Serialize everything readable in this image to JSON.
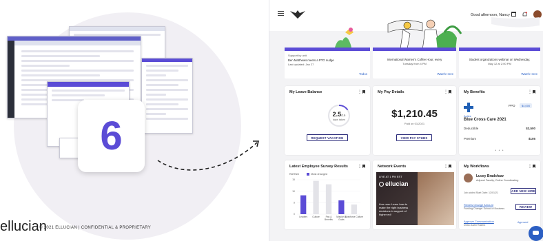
{
  "left": {
    "step_number": "6",
    "brand": "ellucian",
    "copyright": "© 2021 ELLUCIAN | CONFIDENTIAL & PROPRIETARY"
  },
  "header": {
    "greeting": "Good afternoon, Nancy"
  },
  "promos": [
    {
      "title": "Support by unit",
      "line1": "Ben Matthews meets a PTO nudge",
      "line2": "Last updated: Jan 27",
      "link": "Todos"
    },
    {
      "title": "International Women's Coffee Hour, every",
      "line1": "Tuesday from 4 PM",
      "line2": "",
      "link": "Watch Here"
    },
    {
      "title": "Student organizations webinar on Wednesday,",
      "line1": "May 12 at 2:00 PM",
      "line2": "",
      "link": "Watch Here"
    }
  ],
  "cards": {
    "leave": {
      "title": "My Leave Balance",
      "value": "2.5",
      "total": "/16",
      "unit": "days taken",
      "button": "REQUEST VACATION",
      "fraction_used": 0.156
    },
    "pay": {
      "title": "My Pay Details",
      "amount": "$1,210.45",
      "date": "Paid on 01/2021",
      "button": "VIEW PAY STUBS"
    },
    "benefits": {
      "title": "My Benefits",
      "plan_type": "PPO",
      "badge": "$4,000",
      "status": "Active",
      "plan_name": "Blue Cross Care 2021",
      "rows": [
        {
          "label": "Deductible",
          "value": "$3,500"
        },
        {
          "label": "Premium",
          "value": "$105"
        }
      ]
    },
    "survey": {
      "title": "Latest Employee Survey Results",
      "legend_left": "RATING",
      "legend_right": "Most changed",
      "chart_data": {
        "type": "bar",
        "categories": [
          "Leaders",
          "Culture",
          "Pay & Benefits",
          "Mission & Goals",
          "Workforce Culture"
        ],
        "series": [
          {
            "values": [
              8.2,
              0,
              0,
              6.0,
              0
            ]
          },
          {
            "values": [
              0,
              14.5,
              13.0,
              0,
              4.2
            ]
          }
        ],
        "ylim": [
          0,
          15
        ],
        "yticks": [
          0,
          5,
          10,
          15
        ],
        "colors": [
          "#5b4cd6",
          "#e3e3e8"
        ]
      }
    },
    "network": {
      "title": "Network Events",
      "date": "LIVE AT 1 PM EST",
      "brand": "ellucian",
      "caption": "Live now: Learn how to make the right business decisions in support of higher ed!"
    },
    "workflows": {
      "title": "My Workflows",
      "person": "Lucey Bradshaw",
      "role": "Adjunct Faculty, Online Coordinating",
      "added": "Job added Start Date: 12/01/21",
      "new_hire_button": "ADD NEW HIRE",
      "item2_link": "Review Change Amount",
      "item2_note": "Funding Change: School of Business",
      "review_button": "REVIEW",
      "item3_link": "Approve Communication",
      "item3_note": "Dean Justin Rakers",
      "item3_status": "Approved"
    }
  },
  "colors": {
    "accent": "#5b4cd6",
    "link": "#2d63c8",
    "button_border": "#2a2a7a",
    "fab": "#2c5fc3"
  }
}
